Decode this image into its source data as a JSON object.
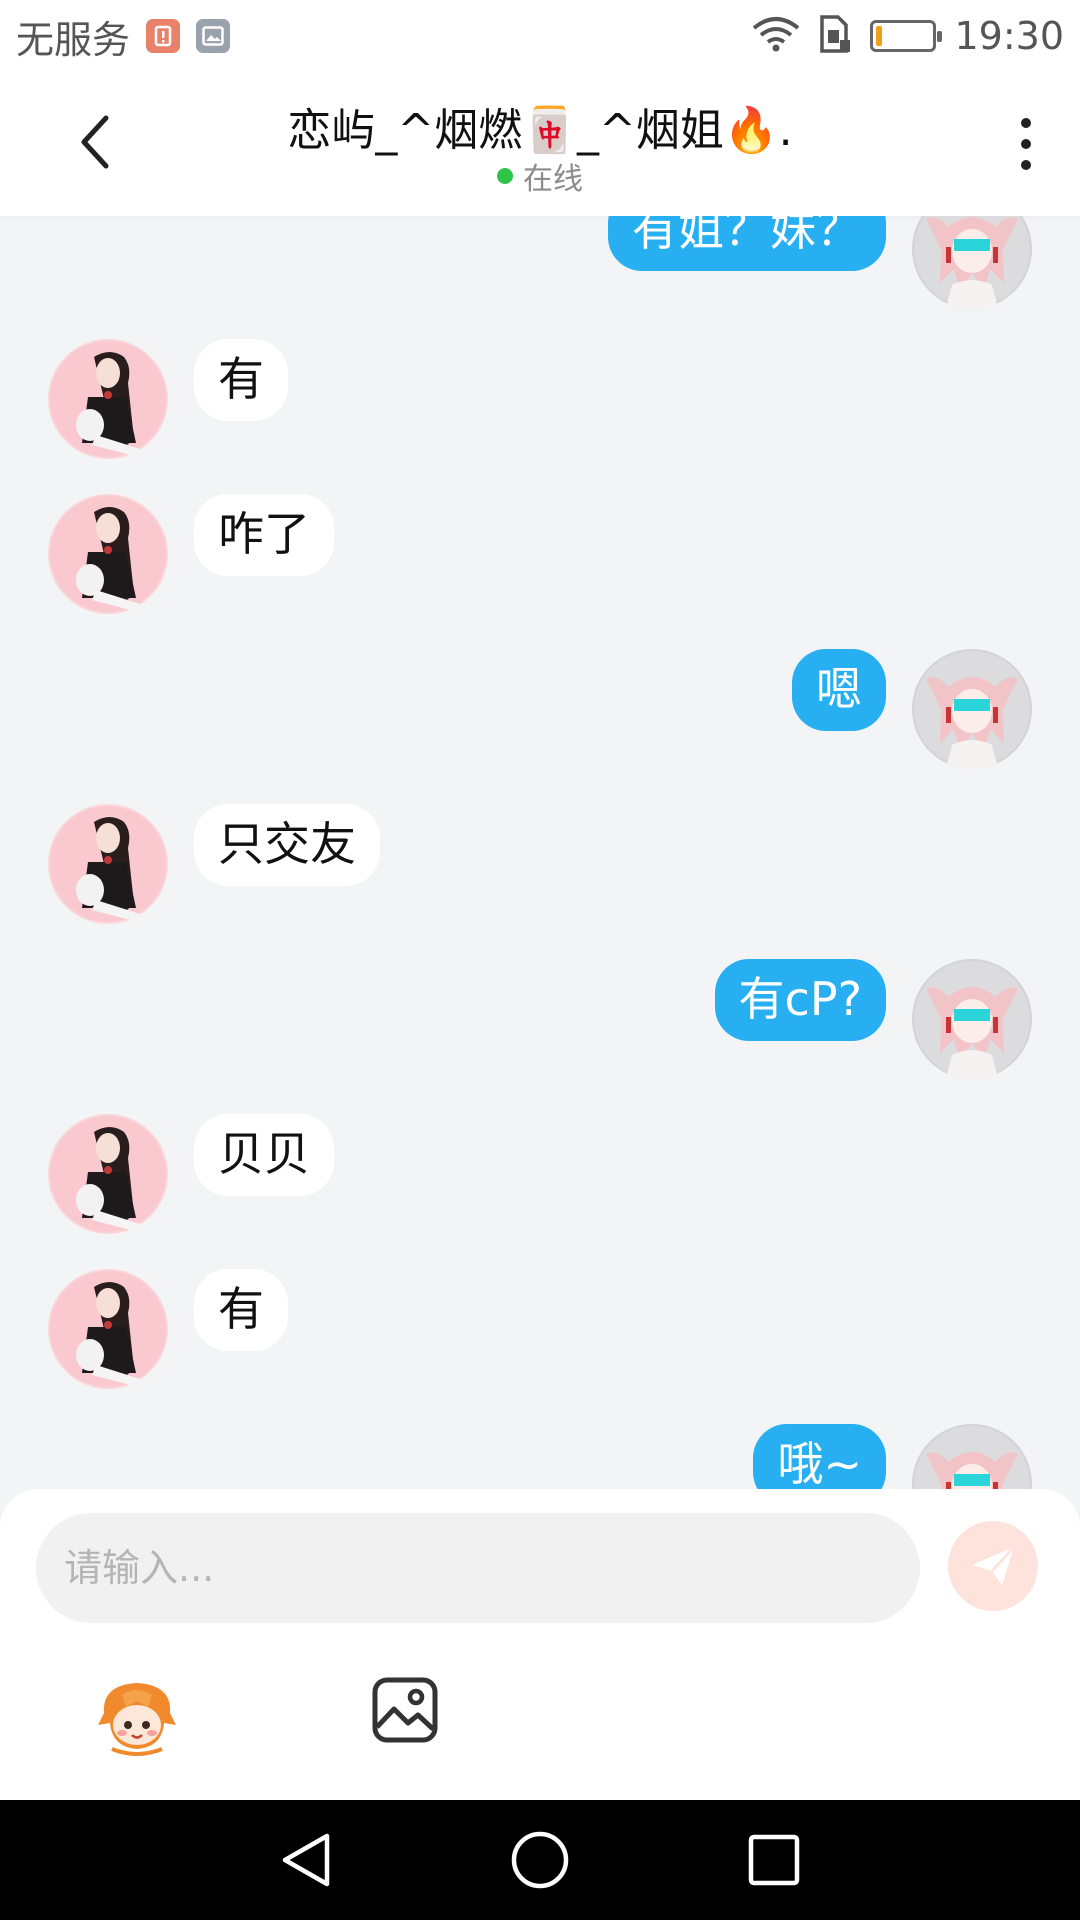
{
  "status_bar": {
    "carrier": "无服务",
    "time": "19:30",
    "icons": [
      "sim-alert-icon",
      "image-notification-icon",
      "wifi-icon",
      "sim-card-icon",
      "battery-icon"
    ]
  },
  "header": {
    "title": "恋屿_^烟燃🀄_^烟姐🔥.",
    "status": "在线",
    "status_color": "#2ec44a",
    "icons": [
      "back-chevron-icon",
      "more-vertical-icon"
    ]
  },
  "messages": [
    {
      "side": "right",
      "text": "有姐？妹？"
    },
    {
      "side": "left",
      "text": "有"
    },
    {
      "side": "left",
      "text": "咋了"
    },
    {
      "side": "right",
      "text": "嗯"
    },
    {
      "side": "left",
      "text": "只交友"
    },
    {
      "side": "right",
      "text": "有cP?"
    },
    {
      "side": "left",
      "text": "贝贝"
    },
    {
      "side": "left",
      "text": "有"
    },
    {
      "side": "right",
      "text": "哦~"
    }
  ],
  "composer": {
    "placeholder": "请输入...",
    "icons": [
      "send-icon",
      "emoji-mascot-icon",
      "image-icon"
    ]
  },
  "nav_bar": {
    "icons": [
      "nav-back-icon",
      "nav-home-icon",
      "nav-recents-icon"
    ]
  },
  "colors": {
    "outgoing_bubble": "#27aff1",
    "incoming_bubble": "#ffffff",
    "chat_background": "#f2f4f6",
    "send_button": "#fde3dc"
  }
}
